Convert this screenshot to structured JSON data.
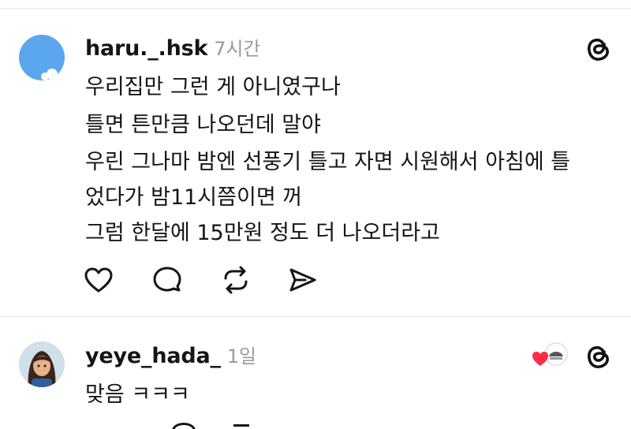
{
  "posts": [
    {
      "username": "haru._.hsk",
      "time": "7시간",
      "lines": [
        "우리집만 그런 게 아니였구나",
        "틀면 튼만큼 나오던데 말야",
        "우린 그나마 밤엔 선풍기 틀고 자면 시원해서 아침에 틀",
        "었다가 밤11시쯤이면 꺼",
        "그럼 한달에 15만원 정도 더 나오더라고"
      ],
      "actions": [
        "heart-icon",
        "comment-icon",
        "repost-icon",
        "share-icon"
      ]
    },
    {
      "username": "yeye_hada_",
      "time": "1일",
      "lines": [
        "맞음 ㅋㅋㅋ"
      ],
      "liked_badge": true
    }
  ],
  "colors": {
    "heart": "#ff2a44",
    "muted": "#9a9a9a"
  },
  "icons": {
    "app": "threads-icon"
  }
}
